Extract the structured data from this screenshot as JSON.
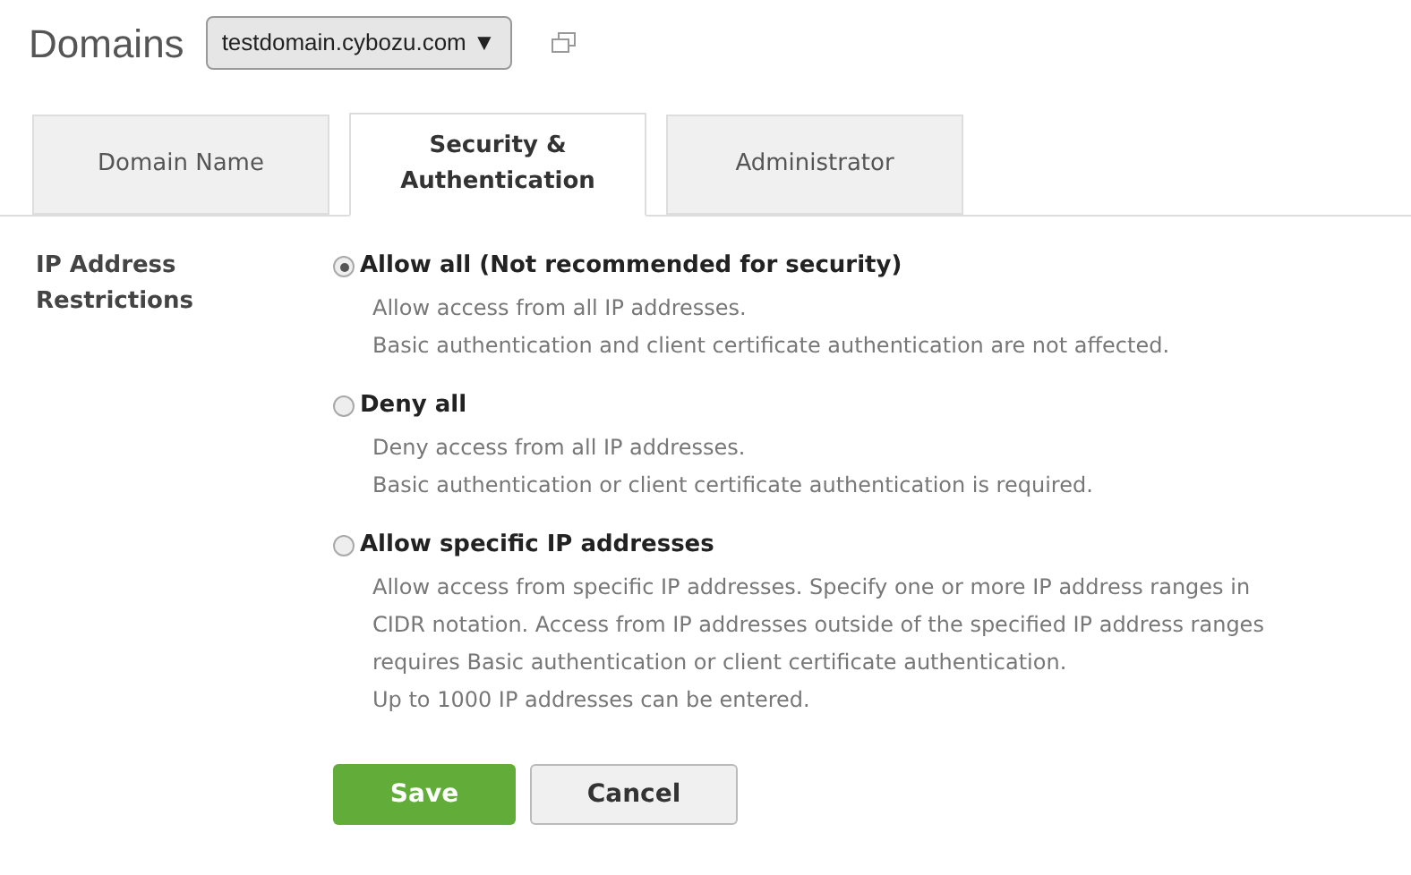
{
  "header": {
    "title": "Domains",
    "domain_select": "testdomain.cybozu.com ▼"
  },
  "tabs": [
    {
      "label": "Domain Name",
      "selected": false
    },
    {
      "label": "Security & Authentication",
      "selected": true
    },
    {
      "label": "Administrator",
      "selected": false
    }
  ],
  "section": {
    "label": "IP Address Restrictions",
    "options": [
      {
        "label": "Allow all (Not recommended for security)",
        "selected": true,
        "description": [
          "Allow access from all IP addresses.",
          "Basic authentication and client certificate authentication are not affected."
        ]
      },
      {
        "label": "Deny all",
        "selected": false,
        "description": [
          "Deny access from all IP addresses.",
          "Basic authentication or client certificate authentication is required."
        ]
      },
      {
        "label": "Allow specific IP addresses",
        "selected": false,
        "description": [
          "Allow access from specific IP addresses. Specify one or more IP address ranges in",
          "CIDR notation. Access from IP addresses outside of the specified IP address ranges",
          "requires Basic authentication or client certificate authentication.",
          "Up to 1000 IP addresses can be entered."
        ]
      }
    ]
  },
  "buttons": [
    {
      "label": "Save",
      "kind": "primary"
    },
    {
      "label": "Cancel",
      "kind": "secondary"
    }
  ]
}
